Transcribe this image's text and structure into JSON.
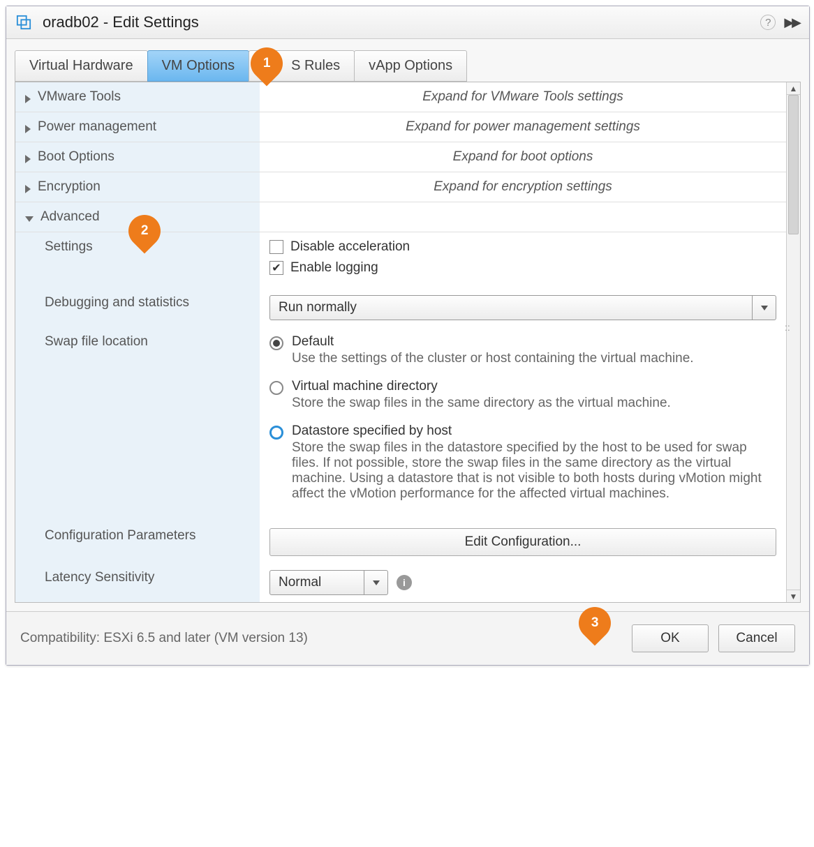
{
  "window": {
    "title": "oradb02 - Edit Settings"
  },
  "tabs": {
    "hardware": "Virtual Hardware",
    "vmoptions": "VM Options",
    "sdrs": "S Rules",
    "vapp": "vApp Options"
  },
  "sections": {
    "vmtools": {
      "label": "VMware Tools",
      "hint": "Expand for VMware Tools settings"
    },
    "power": {
      "label": "Power management",
      "hint": "Expand for power management settings"
    },
    "boot": {
      "label": "Boot Options",
      "hint": "Expand for boot options"
    },
    "encrypt": {
      "label": "Encryption",
      "hint": "Expand for encryption settings"
    },
    "advanced": {
      "label": "Advanced"
    }
  },
  "advanced": {
    "settings_label": "Settings",
    "disable_accel": "Disable acceleration",
    "enable_logging": "Enable logging",
    "debug_label": "Debugging and statistics",
    "debug_value": "Run normally",
    "swap_label": "Swap file location",
    "swap_options": {
      "default": {
        "label": "Default",
        "desc": "Use the settings of the cluster or host containing the virtual machine."
      },
      "vmdir": {
        "label": "Virtual machine directory",
        "desc": "Store the swap files in the same directory as the virtual machine."
      },
      "datastore": {
        "label": "Datastore specified by host",
        "desc": "Store the swap files in the datastore specified by the host to be used for swap files. If not possible, store the swap files in the same directory as the virtual machine. Using a datastore that is not visible to both hosts during vMotion might affect the vMotion performance for the affected virtual machines."
      }
    },
    "config_params_label": "Configuration Parameters",
    "edit_config_btn": "Edit Configuration...",
    "latency_label": "Latency Sensitivity",
    "latency_value": "Normal"
  },
  "footer": {
    "compat": "Compatibility: ESXi 6.5 and later (VM version 13)",
    "ok": "OK",
    "cancel": "Cancel"
  },
  "callouts": {
    "c1": "1",
    "c2": "2",
    "c3": "3"
  }
}
